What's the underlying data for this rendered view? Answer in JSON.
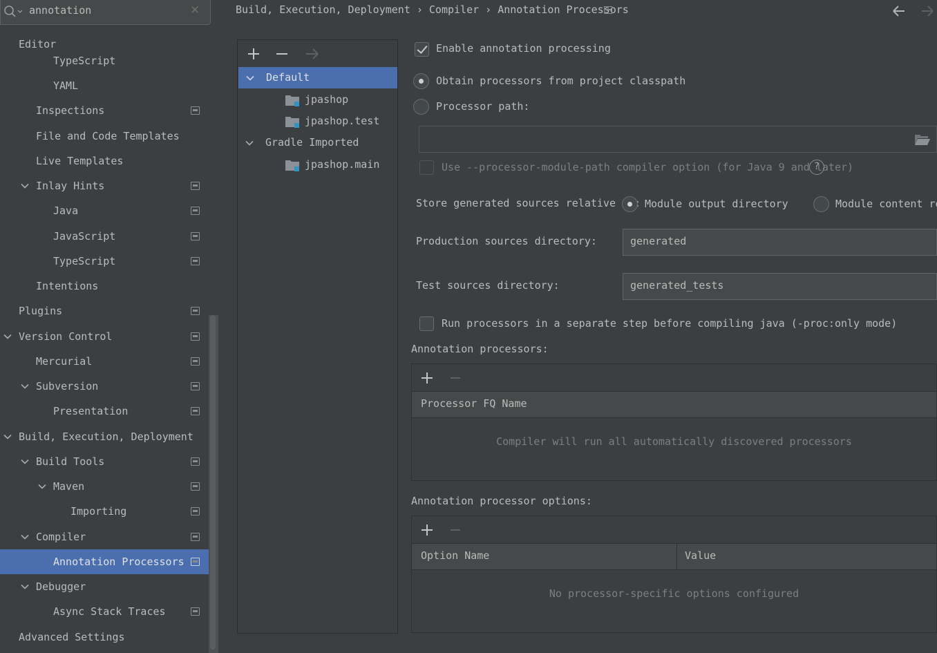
{
  "search": {
    "value": "annotation",
    "icon": "search-icon",
    "clear_icon": "close-icon"
  },
  "sidebar": {
    "items": [
      {
        "label": "Editor"
      },
      {
        "label": "TypeScript"
      },
      {
        "label": "YAML"
      },
      {
        "label": "Inspections"
      },
      {
        "label": "File and Code Templates"
      },
      {
        "label": "Live Templates"
      },
      {
        "label": "Inlay Hints"
      },
      {
        "label": "Java"
      },
      {
        "label": "JavaScript"
      },
      {
        "label": "TypeScript"
      },
      {
        "label": "Intentions"
      },
      {
        "label": "Plugins"
      },
      {
        "label": "Version Control"
      },
      {
        "label": "Mercurial"
      },
      {
        "label": "Subversion"
      },
      {
        "label": "Presentation"
      },
      {
        "label": "Build, Execution, Deployment"
      },
      {
        "label": "Build Tools"
      },
      {
        "label": "Maven"
      },
      {
        "label": "Importing"
      },
      {
        "label": "Compiler"
      },
      {
        "label": "Annotation Processors"
      },
      {
        "label": "Debugger"
      },
      {
        "label": "Async Stack Traces"
      },
      {
        "label": "Advanced Settings"
      }
    ]
  },
  "breadcrumb": {
    "part1": "Build, Execution, Deployment",
    "part2": "Compiler",
    "part3": "Annotation Processors",
    "sep": "›"
  },
  "profiles": {
    "items": [
      {
        "label": "Default"
      },
      {
        "label": "jpashop"
      },
      {
        "label": "jpashop.test"
      },
      {
        "label": "Gradle Imported"
      },
      {
        "label": "jpashop.main"
      }
    ]
  },
  "settings": {
    "enable_label": "Enable annotation processing",
    "obtain_label": "Obtain processors from project classpath",
    "path_label": "Processor path:",
    "path_value": "",
    "module_path_label": "Use --processor-module-path compiler option (for Java 9 and later)",
    "store_label": "Store generated sources relative to:",
    "store_opt1": "Module output directory",
    "store_opt2": "Module content roo",
    "prod_label": "Production sources directory:",
    "prod_value": "generated",
    "test_label": "Test sources directory:",
    "test_value": "generated_tests",
    "run_label": "Run processors in a separate step before compiling java (-proc:only mode)",
    "ap_title": "Annotation processors:",
    "ap_col": "Processor FQ Name",
    "ap_empty": "Compiler will run all automatically discovered processors",
    "opt_title": "Annotation processor options:",
    "opt_col1": "Option Name",
    "opt_col2": "Value",
    "opt_empty": "No processor-specific options configured"
  },
  "colors": {
    "selection": "#4b6eaf",
    "background": "#3c3f41",
    "text": "#bbbbbb",
    "field": "#45494a"
  }
}
